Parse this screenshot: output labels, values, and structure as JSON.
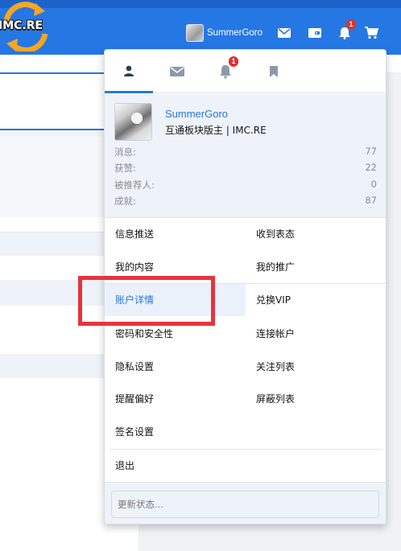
{
  "header": {
    "logo_text": "IMC.RE",
    "username": "SummerGoro",
    "alert_count": "1",
    "icons": [
      "envelope-icon",
      "wallet-icon",
      "bell-icon",
      "cart-icon"
    ]
  },
  "dropdown": {
    "tabs": [
      {
        "name": "user-icon",
        "active": true
      },
      {
        "name": "envelope-icon",
        "active": false
      },
      {
        "name": "bell-icon",
        "active": false,
        "badge": "1"
      },
      {
        "name": "bookmark-icon",
        "active": false
      }
    ],
    "profile": {
      "name": "SummerGoro",
      "title": "互通板块版主 | IMC.RE",
      "stats": [
        {
          "label": "消息:",
          "value": "77"
        },
        {
          "label": "获赞:",
          "value": "22"
        },
        {
          "label": "被推荐人:",
          "value": "0"
        },
        {
          "label": "成就:",
          "value": "87"
        }
      ]
    },
    "menu_left": [
      "信息推送",
      "我的内容",
      "账户详情",
      "密码和安全性",
      "隐私设置",
      "提醒偏好",
      "签名设置"
    ],
    "menu_right": [
      "收到表态",
      "我的推广",
      "兑换VIP",
      "连接帐户",
      "关注列表",
      "屏蔽列表"
    ],
    "logout": "退出",
    "status_placeholder": "更新状态..."
  },
  "colors": {
    "accent": "#2577e3",
    "badge": "#e03030",
    "annotation": "#e8333b"
  }
}
